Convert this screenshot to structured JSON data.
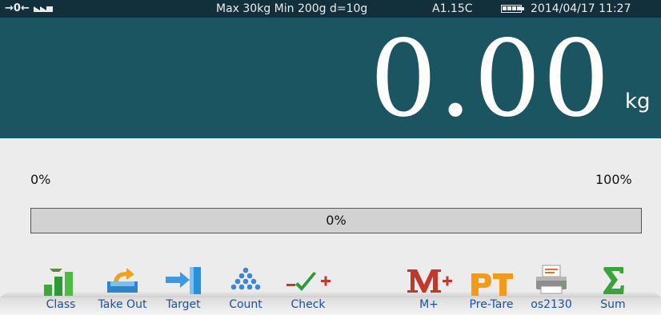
{
  "status": {
    "zero_indicator": "→0←",
    "spec": "Max 30kg  Min 200g  d=10g",
    "version": "A1.15C",
    "datetime": "2014/04/17  11:27"
  },
  "display": {
    "weight": "0.00",
    "unit": "kg"
  },
  "progress": {
    "left_label": "0%",
    "right_label": "100%",
    "value_text": "0%",
    "value": 0
  },
  "function_keys": [
    {
      "label": "Class",
      "icon": "class-bars-icon"
    },
    {
      "label": "Take Out",
      "icon": "take-out-tray-icon"
    },
    {
      "label": "Target",
      "icon": "target-arrow-icon"
    },
    {
      "label": "Count",
      "icon": "count-dots-icon"
    },
    {
      "label": "Check",
      "icon": "check-mark-icon"
    },
    {
      "label": "M+",
      "icon": "memory-plus-icon"
    },
    {
      "label": "Pre-Tare",
      "icon": "pre-tare-pt-icon"
    },
    {
      "label": "os2130",
      "icon": "printer-icon"
    },
    {
      "label": "Sum",
      "icon": "sigma-sum-icon"
    }
  ],
  "colors": {
    "status_bg": "#12303b",
    "display_bg": "#1b5562",
    "panel_bg": "#ececec",
    "key_label": "#1c4fa0"
  }
}
